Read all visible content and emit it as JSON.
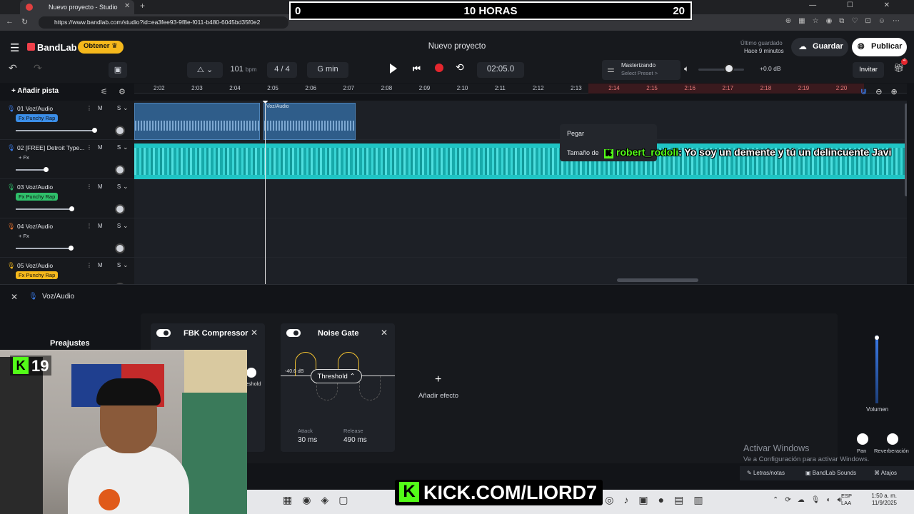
{
  "browser": {
    "tab_title": "Nuevo proyecto - Studio",
    "tab_close": "✕",
    "new_tab": "+",
    "url": "https://www.bandlab.com/studio?id=ea3fee93-9f8e-f011-b480-6045bd35f0e2",
    "window_controls": "— ☐ ✕"
  },
  "stream_overlay": {
    "left": "0",
    "title": "10 HORAS",
    "right": "20",
    "kick_url": "KICK.COM/LIORD7",
    "cam_badge": "19",
    "kick_letter": "K"
  },
  "header": {
    "logo": "BandLab",
    "obtener": "Obtener",
    "project_title": "Nuevo proyecto",
    "saved_label": "Último guardado",
    "saved_time": "Hace 9 minutos",
    "guardar": "Guardar",
    "publicar": "Publicar"
  },
  "toolbar": {
    "bpm": "101",
    "bpm_unit": "bpm",
    "time_signature": "4 / 4",
    "key": "G min",
    "time": "02:05.0",
    "master_title": "Masterizando",
    "master_sub": "Select Preset >",
    "volume_db": "+0.0 dB",
    "invitar": "Invitar",
    "gift_badge": "4"
  },
  "ruler": {
    "ticks": [
      "2:02",
      "2:03",
      "2:04",
      "2:05",
      "2:06",
      "2:07",
      "2:08",
      "2:09",
      "2:10",
      "2:11",
      "2:12",
      "2:13",
      "2:14",
      "2:15",
      "2:16",
      "2:17",
      "2:18",
      "2:19",
      "2:20"
    ]
  },
  "tracks": {
    "add_label": "Añadir pista",
    "items": [
      {
        "name": "01  Voz/Audio",
        "fx": "Fx Punchy Rap",
        "fx_color": "#3b8ee8",
        "mic_color": "#3b7be8",
        "ms": "M S",
        "volume": 0.92
      },
      {
        "name": "02  [FREE] Detroit Type...",
        "fx": "+ Fx",
        "fx_color": "",
        "mic_color": "#3b7be8",
        "ms": "M S",
        "volume": 0.35
      },
      {
        "name": "03  Voz/Audio",
        "fx": "Fx Punchy Rap",
        "fx_color": "#2fbf6a",
        "mic_color": "#2fbf6a",
        "ms": "M S",
        "volume": 0.65
      },
      {
        "name": "04  Voz/Audio",
        "fx": "+ Fx",
        "fx_color": "",
        "mic_color": "#e8732f",
        "ms": "M S",
        "volume": 0.64
      },
      {
        "name": "05  Voz/Audio",
        "fx": "Fx Punchy Rap",
        "fx_color": "#f5b81c",
        "mic_color": "#f5b81c",
        "ms": "M S",
        "volume": 0.5
      }
    ]
  },
  "timeline": {
    "clip_label": "Voz/Audio"
  },
  "context_menu": {
    "paste": "Pegar",
    "size": "Tamaño de"
  },
  "chat": {
    "user": "robert_rodoli",
    "message": ": Yo soy un demente y tú un delincuente Javi"
  },
  "effects": {
    "track_title": "Voz/Audio",
    "presets": "Preajustes",
    "compressor_name": "FBK Compressor",
    "compressor_threshold": "reshold",
    "gate_name": "Noise Gate",
    "gate_db": "-40.6 dB",
    "threshold_btn": "Threshold ⌃",
    "attack_label": "Attack",
    "attack_value": "30 ms",
    "release_label": "Release",
    "release_value": "490 ms",
    "add_effect": "Añadir efecto",
    "volume_label": "Volumen",
    "pan_label": "Pan",
    "reverb_label": "Reverberación"
  },
  "windows": {
    "activate_title": "Activar Windows",
    "activate_sub": "Ve a Configuración para activar Windows.",
    "lang": "ESP",
    "lang_sub": "LAA",
    "clock_time": "1:50 a. m.",
    "clock_date": "11/9/2025"
  },
  "bottom_bar": {
    "lyrics": "Letras/notas",
    "sounds": "BandLab Sounds",
    "shortcuts": "Atajos"
  }
}
